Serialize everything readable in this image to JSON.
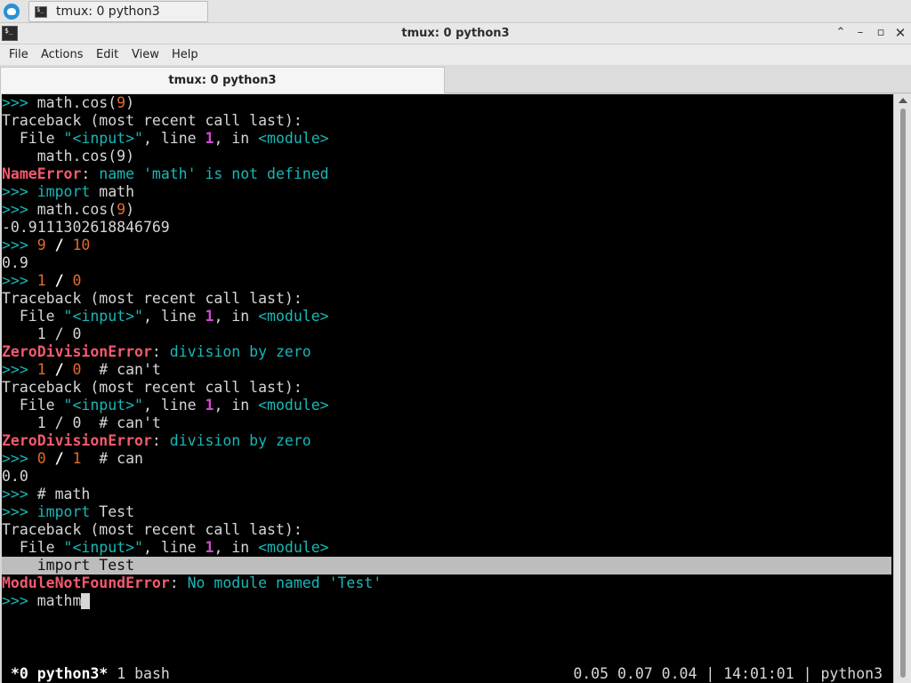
{
  "taskbar": {
    "task_label": "tmux: 0 python3"
  },
  "window": {
    "title": "tmux: 0 python3"
  },
  "menu": [
    "File",
    "Actions",
    "Edit",
    "View",
    "Help"
  ],
  "tab": {
    "label": "tmux: 0 python3"
  },
  "terminal": {
    "lines": [
      [
        [
          "prompt",
          ">>> "
        ],
        [
          "plain",
          "math.cos("
        ],
        [
          "num",
          "9"
        ],
        [
          "plain",
          ")"
        ]
      ],
      [
        [
          "plain",
          "Traceback (most recent call last):"
        ]
      ],
      [
        [
          "plain",
          "  File "
        ],
        [
          "str",
          "\"<input>\""
        ],
        [
          "plain",
          ", line "
        ],
        [
          "lineno",
          "1"
        ],
        [
          "plain",
          ", in "
        ],
        [
          "str",
          "<module>"
        ]
      ],
      [
        [
          "plain",
          "    math.cos(9)"
        ]
      ],
      [
        [
          "err",
          "NameError"
        ],
        [
          "plain",
          ": "
        ],
        [
          "str",
          "name 'math' is not defined"
        ]
      ],
      [
        [
          "prompt",
          ">>> "
        ],
        [
          "kw",
          "import"
        ],
        [
          "plain",
          " math"
        ]
      ],
      [
        [
          "prompt",
          ">>> "
        ],
        [
          "plain",
          "math.cos("
        ],
        [
          "num",
          "9"
        ],
        [
          "plain",
          ")"
        ]
      ],
      [
        [
          "plain",
          "-0.9111302618846769"
        ]
      ],
      [
        [
          "prompt",
          ">>> "
        ],
        [
          "num",
          "9"
        ],
        [
          "plain",
          " "
        ],
        [
          "op",
          "/"
        ],
        [
          "plain",
          " "
        ],
        [
          "num",
          "10"
        ]
      ],
      [
        [
          "plain",
          "0.9"
        ]
      ],
      [
        [
          "prompt",
          ">>> "
        ],
        [
          "num",
          "1"
        ],
        [
          "plain",
          " "
        ],
        [
          "op",
          "/"
        ],
        [
          "plain",
          " "
        ],
        [
          "num",
          "0"
        ]
      ],
      [
        [
          "plain",
          "Traceback (most recent call last):"
        ]
      ],
      [
        [
          "plain",
          "  File "
        ],
        [
          "str",
          "\"<input>\""
        ],
        [
          "plain",
          ", line "
        ],
        [
          "lineno",
          "1"
        ],
        [
          "plain",
          ", in "
        ],
        [
          "str",
          "<module>"
        ]
      ],
      [
        [
          "plain",
          "    1 / 0"
        ]
      ],
      [
        [
          "err",
          "ZeroDivisionError"
        ],
        [
          "plain",
          ": "
        ],
        [
          "str",
          "division by zero"
        ]
      ],
      [
        [
          "prompt",
          ">>> "
        ],
        [
          "num",
          "1"
        ],
        [
          "plain",
          " "
        ],
        [
          "op",
          "/"
        ],
        [
          "plain",
          " "
        ],
        [
          "num",
          "0"
        ],
        [
          "plain",
          "  # can't"
        ]
      ],
      [
        [
          "plain",
          "Traceback (most recent call last):"
        ]
      ],
      [
        [
          "plain",
          "  File "
        ],
        [
          "str",
          "\"<input>\""
        ],
        [
          "plain",
          ", line "
        ],
        [
          "lineno",
          "1"
        ],
        [
          "plain",
          ", in "
        ],
        [
          "str",
          "<module>"
        ]
      ],
      [
        [
          "plain",
          "    1 / 0  # can't"
        ]
      ],
      [
        [
          "err",
          "ZeroDivisionError"
        ],
        [
          "plain",
          ": "
        ],
        [
          "str",
          "division by zero"
        ]
      ],
      [
        [
          "prompt",
          ">>> "
        ],
        [
          "num",
          "0"
        ],
        [
          "plain",
          " "
        ],
        [
          "op",
          "/"
        ],
        [
          "plain",
          " "
        ],
        [
          "num",
          "1"
        ],
        [
          "plain",
          "  # can"
        ]
      ],
      [
        [
          "plain",
          "0.0"
        ]
      ],
      [
        [
          "prompt",
          ">>> "
        ],
        [
          "plain",
          "# math"
        ]
      ],
      [
        [
          "prompt",
          ">>> "
        ],
        [
          "kw",
          "import"
        ],
        [
          "plain",
          " Test"
        ]
      ],
      [
        [
          "plain",
          "Traceback (most recent call last):"
        ]
      ],
      [
        [
          "plain",
          "  File "
        ],
        [
          "str",
          "\"<input>\""
        ],
        [
          "plain",
          ", line "
        ],
        [
          "lineno",
          "1"
        ],
        [
          "plain",
          ", in "
        ],
        [
          "str",
          "<module>"
        ]
      ],
      [
        [
          "plain",
          "    import Test"
        ]
      ],
      [
        [
          "err",
          "ModuleNotFoundError"
        ],
        [
          "plain",
          ": "
        ],
        [
          "str",
          "No module named 'Test'"
        ]
      ],
      [
        [
          "prompt",
          ">>> "
        ],
        [
          "plain",
          "mathm"
        ]
      ]
    ],
    "highlighted_line": 26,
    "cursor_line": 28
  },
  "status": {
    "active_window": "*0 python3*",
    "other_window": " 1 bash",
    "right": "0.05 0.07 0.04 | 14:01:01 | python3"
  },
  "colors": {
    "prompt": "#19b7b7",
    "number": "#e06c2c",
    "error": "#f25a6e",
    "line_number": "#d04ad0",
    "terminal_bg": "#000000"
  },
  "icons": {
    "start": "start-menu-icon",
    "app": "terminal-icon",
    "window_buttons": [
      "maximize-icon",
      "minimize-icon",
      "restore-icon",
      "close-icon"
    ]
  }
}
